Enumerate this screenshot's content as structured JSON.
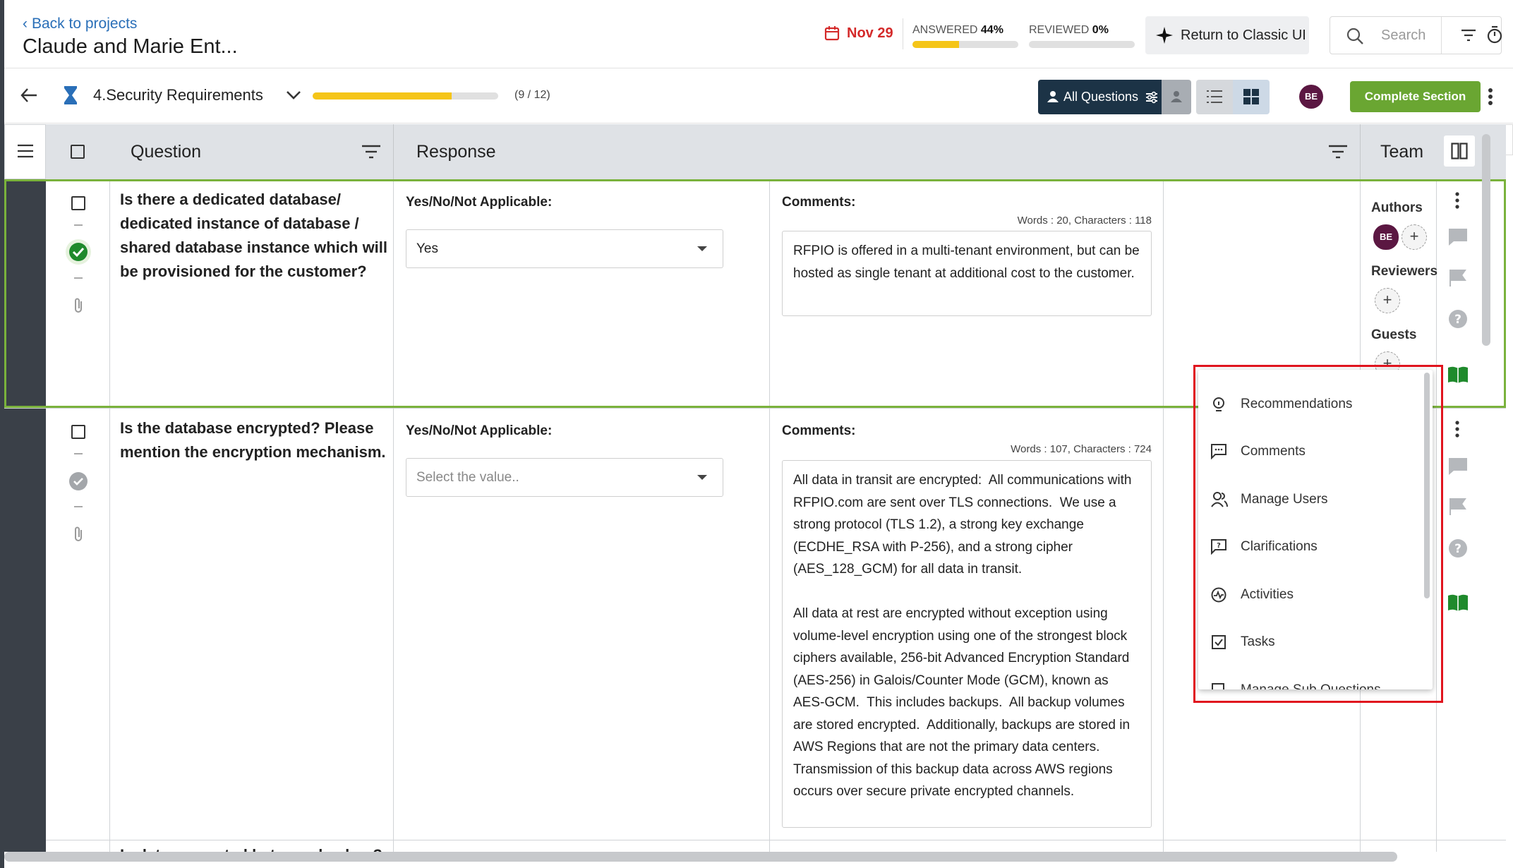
{
  "header": {
    "back_label": "Back to projects",
    "project_title": "Claude and Marie Ent...",
    "due_date": "Nov 29",
    "answered_label": "ANSWERED",
    "answered_pct": "44%",
    "answered_value": 0.44,
    "reviewed_label": "REVIEWED",
    "reviewed_pct": "0%",
    "reviewed_value": 0,
    "classic_button": "Return to Classic UI",
    "search_placeholder": "Search"
  },
  "section": {
    "name": "4.Security Requirements",
    "progress_text": "(9 / 12)",
    "progress_value": 0.75,
    "filter_button": "All Questions",
    "user_initials": "BE",
    "complete_button": "Complete Section"
  },
  "grid": {
    "col_question": "Question",
    "col_response": "Response",
    "col_team": "Team"
  },
  "rows": [
    {
      "question": "Is there a dedicated database/ dedicated instance of database / shared database instance which will be provisioned for the customer?",
      "response_label": "Yes/No/Not Applicable:",
      "response_value": "Yes",
      "comments_label": "Comments:",
      "counts": "Words : 20, Characters : 118",
      "comment": "RFPIO is offered in a multi-tenant environment, but can be hosted as single tenant at additional cost to the customer.",
      "status": "answered"
    },
    {
      "question": "Is the database encrypted? Please mention the encryption mechanism.",
      "response_label": "Yes/No/Not Applicable:",
      "response_placeholder": "Select the value..",
      "comments_label": "Comments:",
      "counts": "Words : 107, Characters : 724",
      "comment": "All data in transit are encrypted:  All communications with RFPIO.com are sent over TLS connections.  We use a strong protocol (TLS 1.2), a strong key exchange (ECDHE_RSA with P-256), and a strong cipher (AES_128_GCM) for all data in transit.\n\nAll data at rest are encrypted without exception using volume-level encryption using one of the strongest block ciphers available, 256-bit Advanced Encryption Standard (AES-256) in Galois/Counter Mode (GCM), known as AES-GCM.  This includes backups.  All backup volumes are stored encrypted.  Additionally, backups are stored in AWS Regions that are not the primary data centers.  Transmission of this backup data across AWS regions occurs over secure private encrypted channels.",
      "status": "pending"
    }
  ],
  "next_row_partial": "Is data encrypted between backup?",
  "team": {
    "authors": "Authors",
    "reviewers": "Reviewers",
    "guests": "Guests",
    "author_initials": "BE"
  },
  "menu": {
    "items": [
      "Recommendations",
      "Comments",
      "Manage Users",
      "Clarifications",
      "Activities",
      "Tasks",
      "Manage Sub Questions"
    ]
  },
  "colors": {
    "accent_green": "#6aa632",
    "progress_yellow": "#f5c518",
    "dark_navy": "#1c3346",
    "highlight_red": "#e0141e"
  }
}
